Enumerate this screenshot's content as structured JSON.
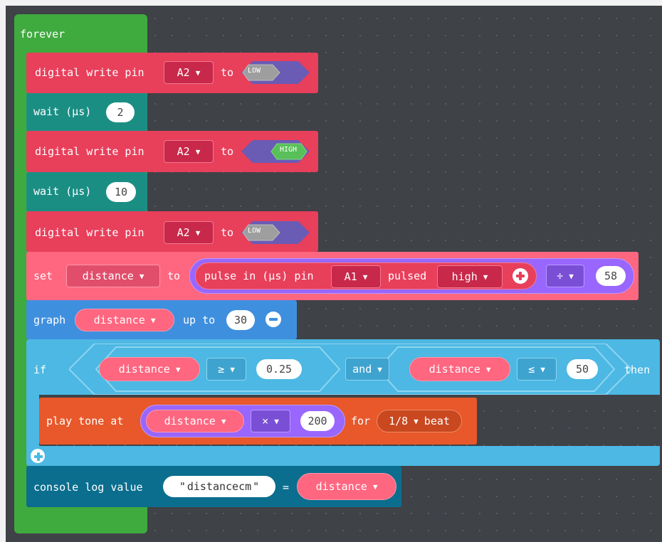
{
  "colors": {
    "workspace": "#3f4247",
    "loops": "#3faa3e",
    "pins": "#e83f5b",
    "pins_dark": "#c8284a",
    "basic_wait": "#1b8e84",
    "variables": "#ff6680",
    "variables_dark": "#e04e6b",
    "math": "#9966ff",
    "math_dark": "#7a4fd6",
    "logic": "#4cb8e3",
    "music": "#e8582a",
    "console": "#0b6e8e",
    "low_bool": "#9e9e9e",
    "high_bool": "#59c059",
    "bool_hex": "#6a5bb5"
  },
  "icons": {
    "add": "plus-circle-icon",
    "remove": "minus-circle-icon",
    "dropdown": "caret-down-icon"
  },
  "blocks": {
    "forever": {
      "label": "forever"
    },
    "write1": {
      "label": "digital write pin",
      "pin": "A2",
      "to": "to",
      "value": "LOW"
    },
    "wait1": {
      "label": "wait (µs)",
      "value": "2"
    },
    "write2": {
      "label": "digital write pin",
      "pin": "A2",
      "to": "to",
      "value": "HIGH"
    },
    "wait2": {
      "label": "wait (µs)",
      "value": "10"
    },
    "write3": {
      "label": "digital write pin",
      "pin": "A2",
      "to": "to",
      "value": "LOW"
    },
    "set": {
      "label": "set",
      "variable": "distance",
      "to": "to",
      "pulse_label": "pulse in (µs) pin",
      "pulse_pin": "A1",
      "pulsed_label": "pulsed",
      "pulsed_value": "high",
      "operator": "÷",
      "divisor": "58"
    },
    "graph": {
      "label": "graph",
      "variable": "distance",
      "up_to": "up to",
      "value": "30"
    },
    "if": {
      "label": "if",
      "left_var": "distance",
      "left_op": "≥",
      "left_value": "0.25",
      "logic_op": "and",
      "right_var": "distance",
      "right_op": "≤",
      "right_value": "50",
      "then": "then"
    },
    "tone": {
      "label": "play tone at",
      "variable": "distance",
      "operator": "×",
      "value": "200",
      "for": "for",
      "beat_value": "1/8",
      "beat": "beat"
    },
    "console": {
      "label": "console log value",
      "quote": "\"",
      "text": "distancecm",
      "equals": "=",
      "variable": "distance"
    }
  }
}
